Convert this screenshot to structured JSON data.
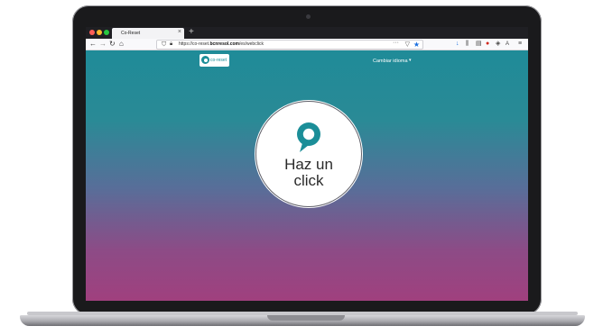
{
  "browser": {
    "tab_title": "Co-Reset",
    "tab_close": "×",
    "new_tab": "+",
    "nav": {
      "back": "←",
      "forward": "→",
      "reload": "↻",
      "home": "⌂"
    },
    "url_prefix": "https://co-reset.",
    "url_domain": "bcnresol.com",
    "url_path": "/es/webclick",
    "url_actions": {
      "more": "···",
      "pocket": "▽",
      "bookmark": "★"
    },
    "extensions": [
      {
        "name": "download-icon",
        "glyph": "↓",
        "color": "#1a6fe0"
      },
      {
        "name": "library-icon",
        "glyph": "⫼",
        "color": "#444444"
      },
      {
        "name": "reader-icon",
        "glyph": "▤",
        "color": "#444444"
      },
      {
        "name": "block-icon",
        "glyph": "●",
        "color": "#d0281e"
      },
      {
        "name": "extension-icon",
        "glyph": "◈",
        "color": "#444444"
      },
      {
        "name": "translate-icon",
        "glyph": "A",
        "color": "#444444"
      },
      {
        "name": "menu-icon",
        "glyph": "≡",
        "color": "#444444"
      }
    ],
    "traffic_lights": [
      "#ff5f57",
      "#febc2e",
      "#28c840"
    ]
  },
  "page": {
    "logo_text": "co-reset",
    "language_label": "Cambiar idioma",
    "language_caret": "▾",
    "cta_line1": "Haz un",
    "cta_line2": "click",
    "accent_color": "#1b8e98",
    "gradient_top": "#1f8b98",
    "gradient_bottom": "#a0407e"
  }
}
